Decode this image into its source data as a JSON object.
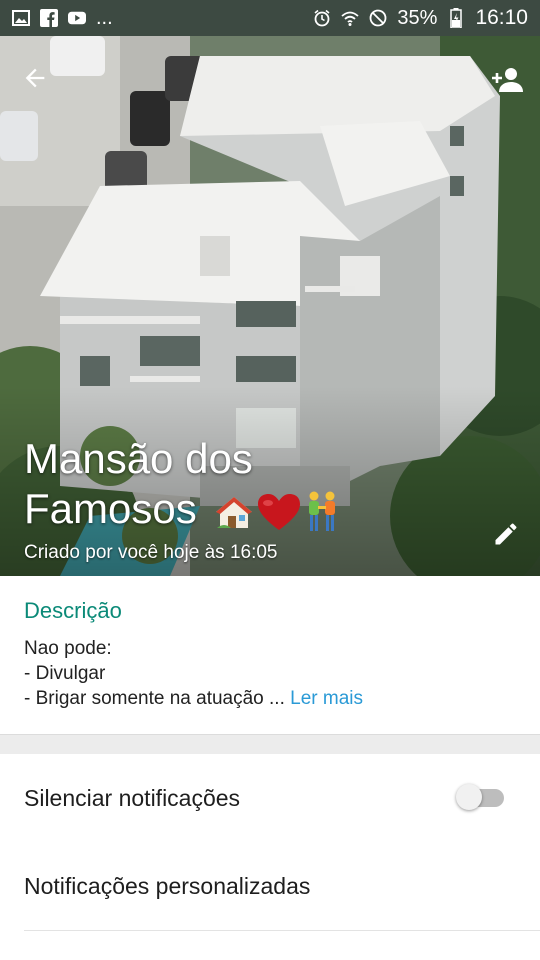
{
  "status_bar": {
    "dots": "...",
    "battery": "35%",
    "time": "16:10",
    "left_icons": [
      "gallery-icon",
      "facebook-icon",
      "youtube-icon"
    ],
    "right_icons": [
      "alarm-icon",
      "wifi-icon",
      "do-not-disturb-icon",
      "battery-icon"
    ]
  },
  "header": {
    "title_line1": "Mansão dos",
    "title_line2": "Famosos",
    "emojis": [
      "house-emoji",
      "heart-emoji",
      "couple-emoji"
    ],
    "created_text": "Criado por você hoje às 16:05"
  },
  "description": {
    "heading": "Descrição",
    "line1": "Nao pode:",
    "line2": "- Divulgar",
    "line3": "- Brigar somente na atuação ...",
    "read_more": "Ler mais"
  },
  "settings": {
    "mute_label": "Silenciar notificações",
    "mute_enabled": false,
    "custom_label": "Notificações personalizadas"
  },
  "colors": {
    "accent_teal": "#0b8a78",
    "link_blue": "#2a9ad6",
    "status_bar": "#3d4a42"
  }
}
